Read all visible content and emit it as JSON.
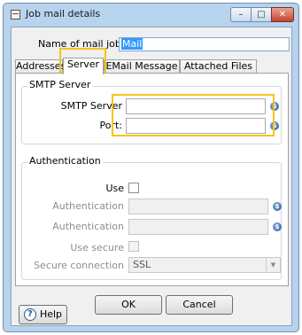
{
  "window": {
    "title": "Job mail details",
    "minimize_glyph": "–",
    "maximize_glyph": "□",
    "close_glyph": "✕"
  },
  "name": {
    "label": "Name of mail job",
    "value": "Mail"
  },
  "tabs": [
    {
      "label": "Addresses"
    },
    {
      "label": "Server",
      "active": true
    },
    {
      "label": "EMail Message"
    },
    {
      "label": "Attached Files"
    }
  ],
  "smtp": {
    "group_title": "SMTP Server",
    "server_label": "SMTP Server",
    "server_value": "",
    "port_label": "Port:",
    "port_value": ""
  },
  "auth": {
    "group_title": "Authentication",
    "use_label": "Use",
    "auth_user_label": "Authentication",
    "auth_pass_label": "Authentication",
    "use_secure_label": "Use secure",
    "secure_connection_label": "Secure connection",
    "secure_connection_value": "SSL"
  },
  "buttons": {
    "ok": "OK",
    "cancel": "Cancel",
    "help": "Help"
  },
  "icons": {
    "variable": "diamond-variable-icon",
    "help": "help-circle-icon"
  },
  "colors": {
    "highlight": "#f5c518",
    "selection": "#3399ff",
    "frame": "#b8d3ee"
  }
}
